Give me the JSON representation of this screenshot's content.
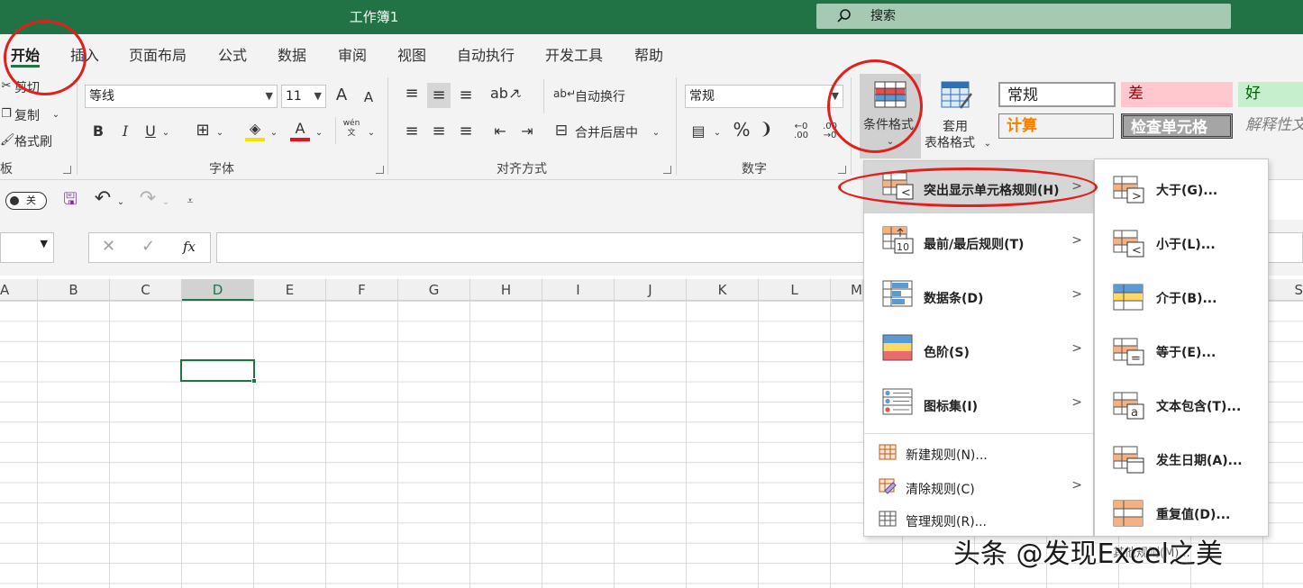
{
  "window": {
    "title": "工作簿1",
    "search_placeholder": "搜索"
  },
  "tabs": [
    "开始",
    "插入",
    "页面布局",
    "公式",
    "数据",
    "审阅",
    "视图",
    "自动执行",
    "开发工具",
    "帮助"
  ],
  "clipboard": {
    "cut": "剪切",
    "copy": "复制",
    "format_painter": "格式刷",
    "group": "板"
  },
  "font": {
    "name": "等线",
    "size": "11",
    "group": "字体",
    "bold": "B",
    "italic": "I",
    "underline": "U",
    "grow": "A",
    "shrink": "A",
    "font_color": "A",
    "phonetic_top": "wén",
    "phonetic_bottom": "文"
  },
  "alignment": {
    "wrap_text": "自动换行",
    "merge_center": "合并后居中",
    "group": "对齐方式"
  },
  "number": {
    "format": "常规",
    "percent": "%",
    "comma": "❩",
    "group": "数字"
  },
  "conditional_format": {
    "label": "条件格式"
  },
  "table_format": {
    "label_top": "套用",
    "label_bottom": "表格格式"
  },
  "styles": {
    "normal": "常规",
    "bad": "差",
    "good": "好",
    "calc": "计算",
    "check_cell": "检查单元格",
    "explanatory": "解释性文"
  },
  "qat": {
    "autosave_state": "关"
  },
  "formula_bar": {
    "fx": "fx"
  },
  "columns": [
    "A",
    "B",
    "C",
    "D",
    "E",
    "F",
    "G",
    "H",
    "I",
    "J",
    "K",
    "L",
    "M",
    "S"
  ],
  "cf_menu": {
    "items": [
      {
        "label": "突出显示单元格规则(H)",
        "has_submenu": true
      },
      {
        "label": "最前/最后规则(T)",
        "has_submenu": true
      },
      {
        "label": "数据条(D)",
        "has_submenu": true
      },
      {
        "label": "色阶(S)",
        "has_submenu": true
      },
      {
        "label": "图标集(I)",
        "has_submenu": true
      }
    ],
    "small_items": [
      {
        "label": "新建规则(N)..."
      },
      {
        "label": "清除规则(C)",
        "has_submenu": true
      },
      {
        "label": "管理规则(R)..."
      }
    ],
    "chevron": ">"
  },
  "highlight_submenu": {
    "items": [
      "大于(G)...",
      "小于(L)...",
      "介于(B)...",
      "等于(E)...",
      "文本包含(T)...",
      "发生日期(A)...",
      "重复值(D)..."
    ],
    "footer_partial": "其他规则(M)..."
  },
  "watermark": "头条 @发现Excel之美",
  "colors": {
    "excel_green": "#217346",
    "annotation_red": "#e0201c"
  }
}
